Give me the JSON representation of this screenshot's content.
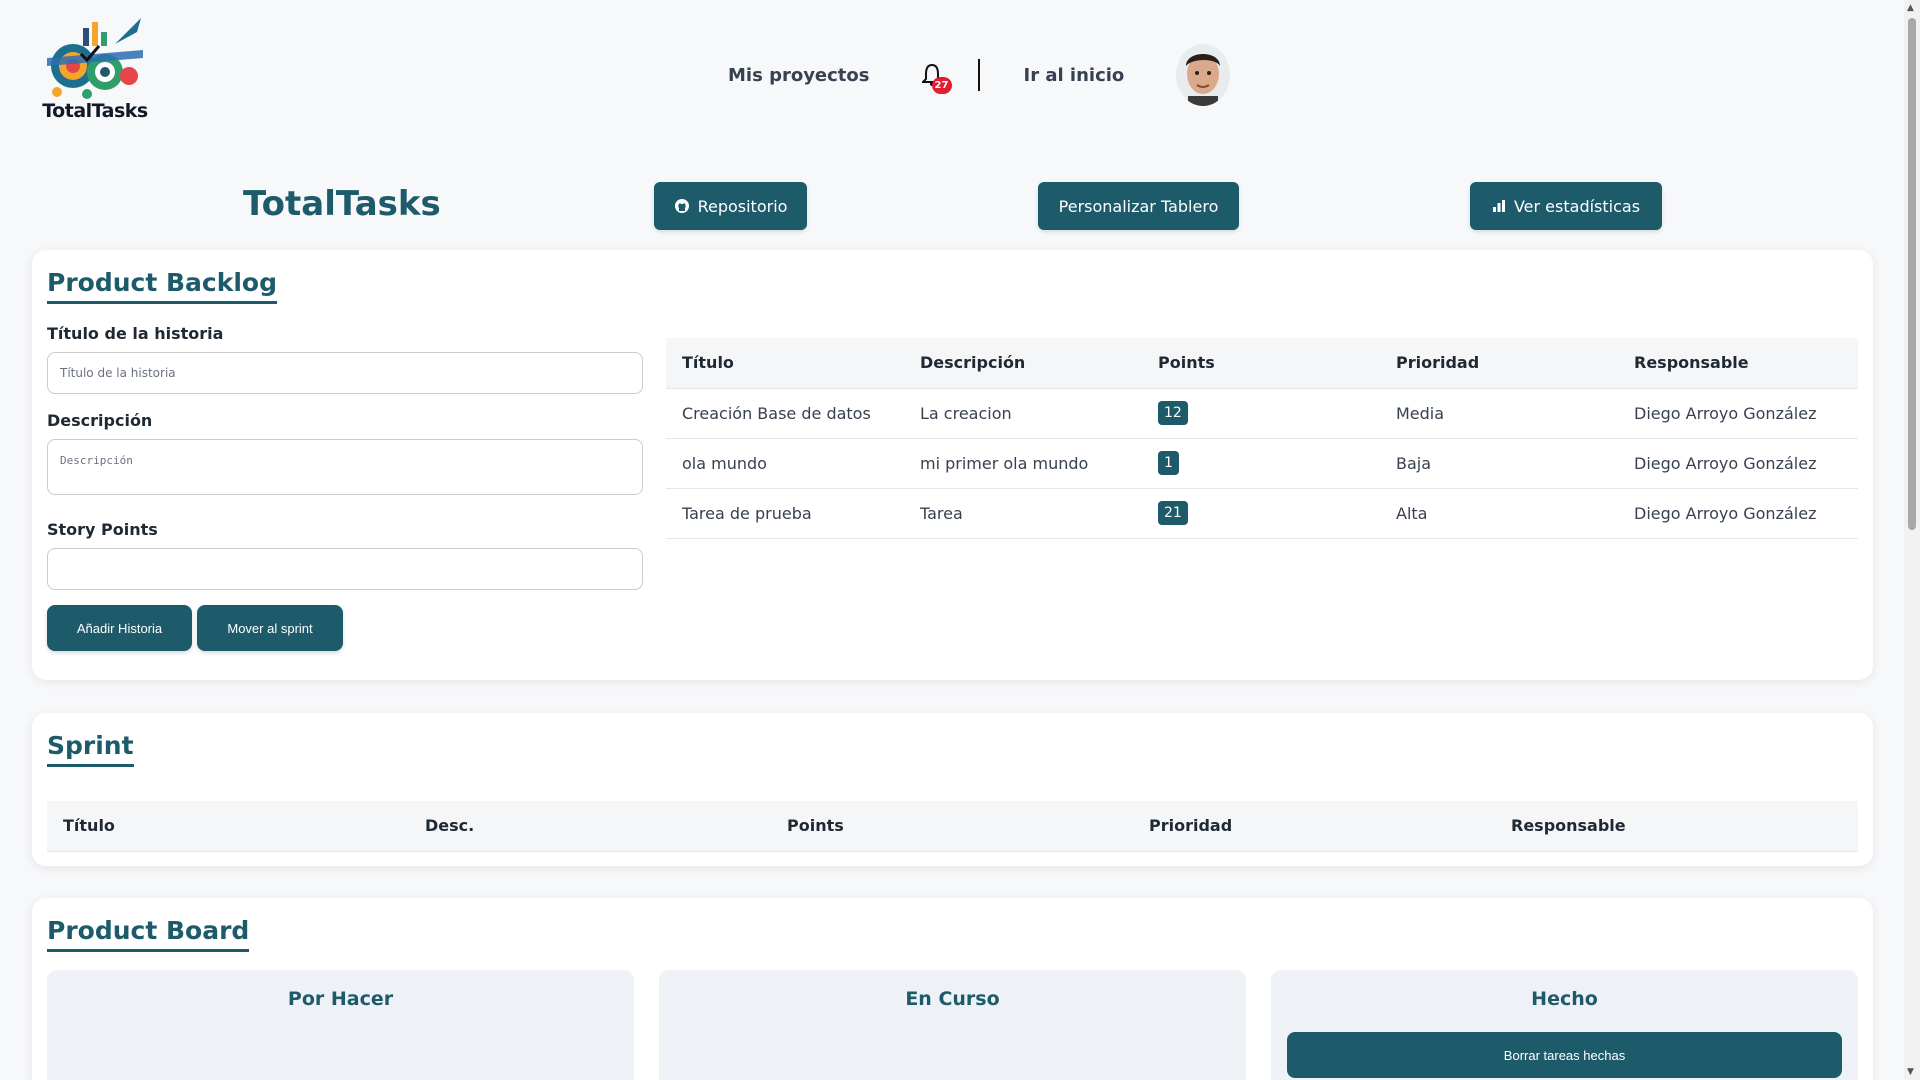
{
  "header": {
    "logo_text": "TotalTasks",
    "nav": {
      "projects": "Mis proyectos",
      "notifications_count": "27",
      "home": "Ir al inicio"
    }
  },
  "title_bar": {
    "app_title": "TotalTasks",
    "repo_button": "Repositorio",
    "customize_button": "Personalizar Tablero",
    "stats_button": "Ver estadísticas"
  },
  "backlog": {
    "title": "Product Backlog",
    "form": {
      "title_label": "Título de la historia",
      "title_placeholder": "Título de la historia",
      "description_label": "Descripción",
      "description_placeholder": "Descripción",
      "points_label": "Story Points",
      "points_value": "",
      "add_button": "Añadir Historia",
      "move_button": "Mover al sprint"
    },
    "table": {
      "headers": [
        "Título",
        "Descripción",
        "Points",
        "Prioridad",
        "Responsable"
      ],
      "rows": [
        {
          "title": "Creación Base de datos",
          "description": "La creacion",
          "points": "12",
          "priority": "Media",
          "owner": "Diego Arroyo González"
        },
        {
          "title": "ola mundo",
          "description": "mi primer ola mundo",
          "points": "1",
          "priority": "Baja",
          "owner": "Diego Arroyo González"
        },
        {
          "title": "Tarea de prueba",
          "description": "Tarea",
          "points": "21",
          "priority": "Alta",
          "owner": "Diego Arroyo González"
        }
      ]
    }
  },
  "sprint": {
    "title": "Sprint",
    "headers": [
      "Título",
      "Desc.",
      "Points",
      "Prioridad",
      "Responsable"
    ]
  },
  "board": {
    "title": "Product Board",
    "columns": [
      "Por Hacer",
      "En Curso",
      "Hecho"
    ],
    "clear_button": "Borrar tareas hechas"
  },
  "colors": {
    "accent": "#1d5b6b",
    "badge": "#e11d2e",
    "background": "#f7f8fa"
  }
}
